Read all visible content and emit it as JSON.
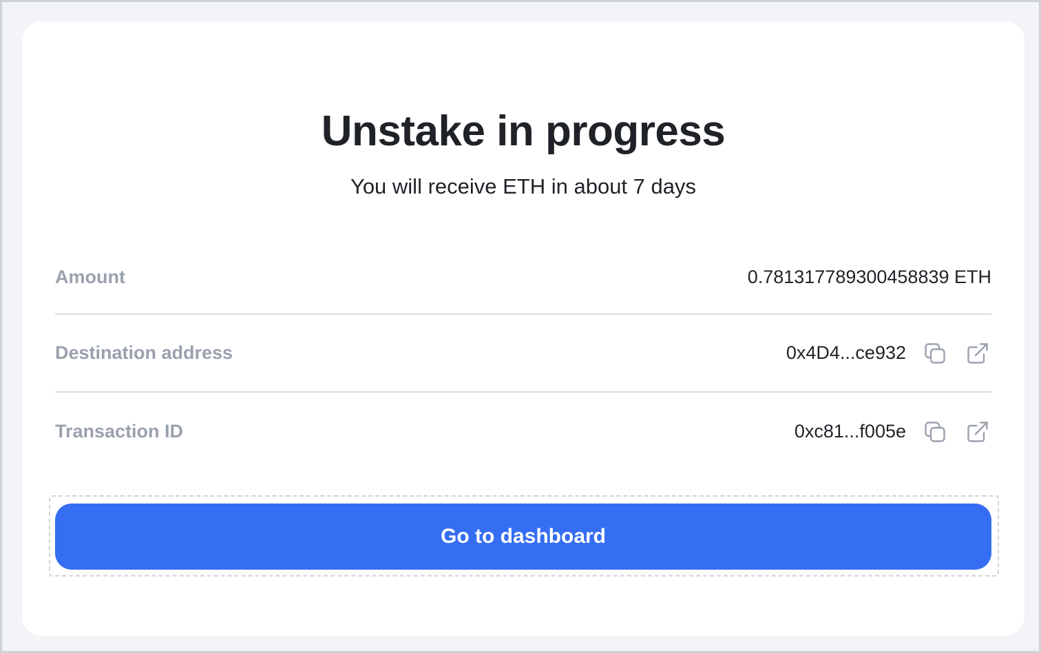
{
  "title": "Unstake in progress",
  "subtitle": "You will receive ETH in about 7 days",
  "details": [
    {
      "label": "Amount",
      "value": "0.781317789300458839 ETH"
    },
    {
      "label": "Destination address",
      "value": "0x4D4...ce932",
      "icons": [
        "copy-icon",
        "external-link-icon"
      ]
    },
    {
      "label": "Transaction ID",
      "value": "0xc81...f005e",
      "icons": [
        "copy-icon",
        "external-link-icon"
      ]
    }
  ],
  "primary_button": {
    "label": "Go to dashboard",
    "color": "#356ef2"
  },
  "colors": {
    "label_gray": "#9aa1ad",
    "text_dark": "#1f2328",
    "icon_gray": "#9aa1ad"
  }
}
